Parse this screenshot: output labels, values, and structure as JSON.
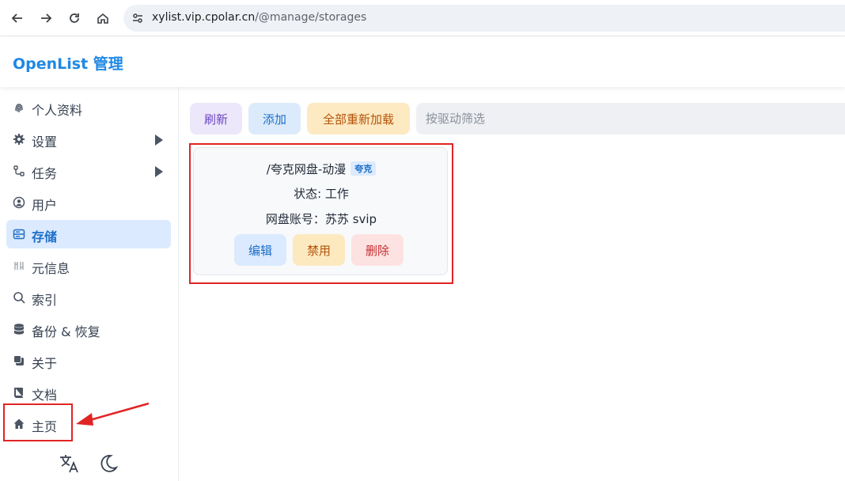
{
  "browser": {
    "url_host": "xylist.vip.cpolar.cn",
    "url_path": "/@manage/storages"
  },
  "app": {
    "title": "OpenList 管理"
  },
  "sidebar": {
    "items": [
      {
        "label": "个人资料",
        "icon": "fingerprint-icon"
      },
      {
        "label": "设置",
        "icon": "gear-icon",
        "expandable": true
      },
      {
        "label": "任务",
        "icon": "workflow-icon",
        "expandable": true
      },
      {
        "label": "用户",
        "icon": "user-circle-icon"
      },
      {
        "label": "存储",
        "icon": "storage-icon",
        "active": true
      },
      {
        "label": "元信息",
        "icon": "meta-icon"
      },
      {
        "label": "索引",
        "icon": "search-icon"
      },
      {
        "label": "备份 & 恢复",
        "icon": "database-icon"
      },
      {
        "label": "关于",
        "icon": "copy-icon"
      },
      {
        "label": "文档",
        "icon": "book-icon"
      },
      {
        "label": "主页",
        "icon": "home-icon"
      }
    ]
  },
  "toolbar": {
    "refresh_label": "刷新",
    "add_label": "添加",
    "reload_all_label": "全部重新加载",
    "filter_placeholder": "按驱动筛选"
  },
  "storage_card": {
    "mount_path": "/夸克网盘-动漫",
    "driver_badge": "夸克",
    "status_line": "状态: 工作",
    "account_line": "网盘账号：苏苏 svip",
    "edit_label": "编辑",
    "disable_label": "禁用",
    "delete_label": "删除"
  },
  "colors": {
    "accent": "#1e88e5",
    "highlight_outline": "#e02424",
    "active_item_bg": "#dbeafe"
  }
}
